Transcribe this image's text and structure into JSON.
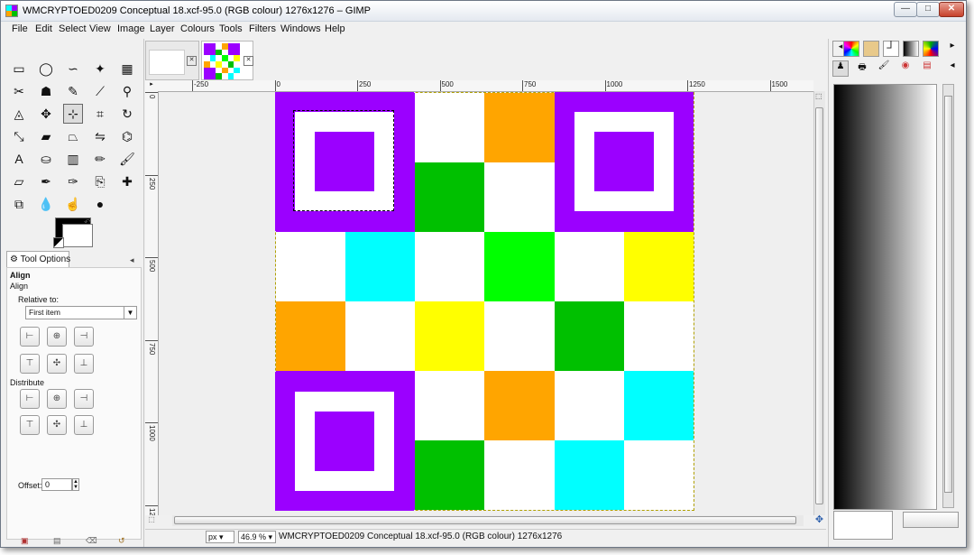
{
  "window": {
    "title": "WMCRYPTOED0209 Conceptual 18.xcf-95.0 (RGB colour) 1276x1276 – GIMP",
    "controls": {
      "minimize": "—",
      "maximize": "□",
      "close": "✕"
    }
  },
  "menubar": {
    "items": [
      "File",
      "Edit",
      "Select",
      "View",
      "Image",
      "Layer",
      "Colours",
      "Tools",
      "Filters",
      "Windows",
      "Help"
    ]
  },
  "toolbox": {
    "tools": [
      {
        "name": "rect-select-icon",
        "glyph": "▭"
      },
      {
        "name": "ellipse-select-icon",
        "glyph": "◯"
      },
      {
        "name": "free-select-icon",
        "glyph": "∽"
      },
      {
        "name": "fuzzy-select-icon",
        "glyph": "✦"
      },
      {
        "name": "select-by-color-icon",
        "glyph": "▦"
      },
      {
        "name": "scissors-icon",
        "glyph": "✂"
      },
      {
        "name": "foreground-select-icon",
        "glyph": "☗"
      },
      {
        "name": "paths-icon",
        "glyph": "✎"
      },
      {
        "name": "color-picker-icon",
        "glyph": "⟋"
      },
      {
        "name": "zoom-icon",
        "glyph": "⚲"
      },
      {
        "name": "measure-icon",
        "glyph": "◬"
      },
      {
        "name": "move-icon",
        "glyph": "✥"
      },
      {
        "name": "align-icon",
        "glyph": "⊹"
      },
      {
        "name": "crop-icon",
        "glyph": "⌗"
      },
      {
        "name": "rotate-icon",
        "glyph": "↻"
      },
      {
        "name": "scale-icon",
        "glyph": "⤡"
      },
      {
        "name": "shear-icon",
        "glyph": "▰"
      },
      {
        "name": "perspective-icon",
        "glyph": "⏢"
      },
      {
        "name": "flip-icon",
        "glyph": "⇋"
      },
      {
        "name": "cage-icon",
        "glyph": "⌬"
      },
      {
        "name": "text-icon",
        "glyph": "A"
      },
      {
        "name": "bucket-fill-icon",
        "glyph": "⛀"
      },
      {
        "name": "blend-icon",
        "glyph": "▥"
      },
      {
        "name": "pencil-icon",
        "glyph": "✏"
      },
      {
        "name": "paintbrush-icon",
        "glyph": "🖌"
      },
      {
        "name": "eraser-icon",
        "glyph": "▱"
      },
      {
        "name": "airbrush-icon",
        "glyph": "✒"
      },
      {
        "name": "ink-icon",
        "glyph": "✑"
      },
      {
        "name": "clone-icon",
        "glyph": "⎘"
      },
      {
        "name": "heal-icon",
        "glyph": "✚"
      },
      {
        "name": "perspective-clone-icon",
        "glyph": "⧉"
      },
      {
        "name": "blur-icon",
        "glyph": "💧"
      },
      {
        "name": "smudge-icon",
        "glyph": "☝"
      },
      {
        "name": "dodge-burn-icon",
        "glyph": "●"
      }
    ],
    "selected_tool": "align-icon"
  },
  "tool_options": {
    "tab_label": "Tool Options",
    "title": "Align",
    "subtitle": "Align",
    "relative_to_label": "Relative to:",
    "relative_to_value": "First item",
    "distribute_label": "Distribute",
    "offset_label": "Offset:",
    "offset_value": "0"
  },
  "image_tabs": [
    {
      "label": "",
      "active": false
    },
    {
      "label": "",
      "active": true
    }
  ],
  "rulers": {
    "horizontal": [
      "-250",
      "0",
      "250",
      "500",
      "750",
      "1000",
      "1250",
      "1500"
    ],
    "vertical": [
      "0",
      "250",
      "500",
      "750",
      "1000",
      "1250"
    ]
  },
  "image": {
    "colors": {
      "purple": "#9b00ff",
      "orange": "#ffa500",
      "green": "#00c000",
      "lime": "#00ff00",
      "cyan": "#00ffff",
      "yellow": "#ffff00",
      "white": "#ffffff"
    },
    "grid": [
      [
        "P",
        "P",
        "W",
        "O",
        "P",
        "P"
      ],
      [
        "P",
        "P",
        "G",
        "W",
        "P",
        "P"
      ],
      [
        "W",
        "C",
        "W",
        "L",
        "W",
        "Y"
      ],
      [
        "O",
        "W",
        "Y",
        "W",
        "G",
        "W"
      ],
      [
        "P",
        "P",
        "W",
        "O",
        "W",
        "C"
      ],
      [
        "P",
        "P",
        "G",
        "W",
        "C",
        "W"
      ]
    ]
  },
  "statusbar": {
    "unit": "px",
    "zoom": "46.9 %",
    "text": "WMCRYPTOED0209 Conceptual 18.xcf-95.0 (RGB colour) 1276x1276"
  },
  "right_panel": {
    "gradient": {
      "start": "#000000",
      "end": "#ffffff"
    }
  }
}
